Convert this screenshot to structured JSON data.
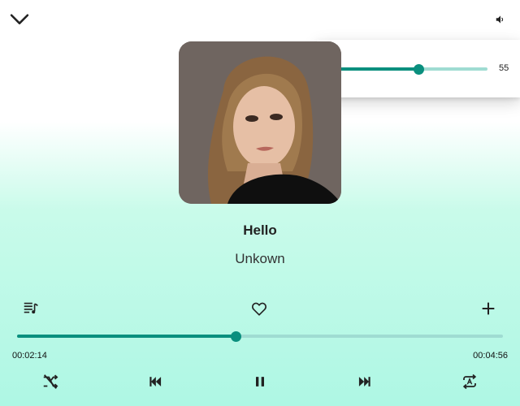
{
  "track": {
    "title": "Hello",
    "artist": "Unkown",
    "elapsed": "00:02:14",
    "duration": "00:04:56",
    "progress_fraction": 0.45
  },
  "volume": {
    "value": "55",
    "level": 55
  },
  "icons": {
    "collapse": "chevron-down-icon",
    "volume": "volume-icon",
    "queue": "queue-music-icon",
    "favorite": "heart-outline-icon",
    "add": "plus-icon",
    "shuffle": "shuffle-off-icon",
    "previous": "skip-previous-icon",
    "play_pause": "pause-icon",
    "next": "skip-next-icon",
    "repeat": "repeat-all-icon"
  },
  "colors": {
    "accent": "#0a8f7e",
    "track_inactive": "#9fdcd2",
    "background_bottom": "#aef7e4"
  }
}
